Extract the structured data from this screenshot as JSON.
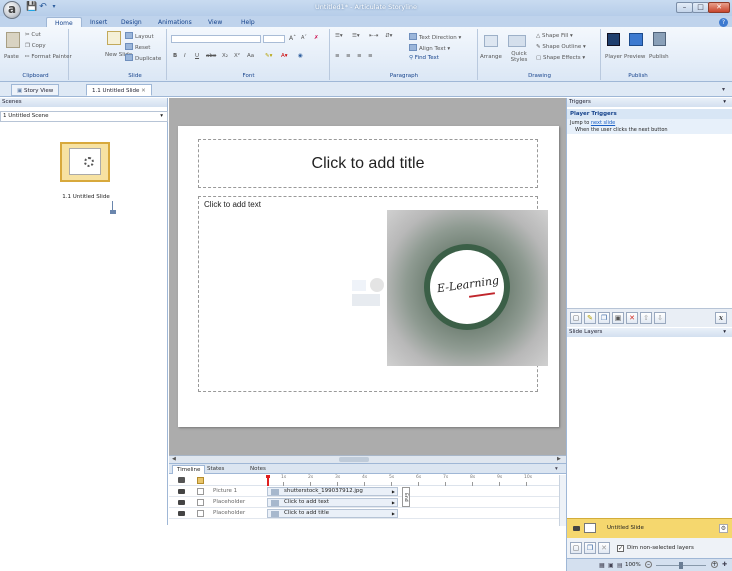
{
  "window": {
    "title": "Untitled1* - Articulate Storyline",
    "app_button": "a"
  },
  "qat": [
    "save-icon",
    "undo-icon",
    "dropdown-icon"
  ],
  "ribbon_tabs": [
    "Home",
    "Insert",
    "Design",
    "Animations",
    "View",
    "Help"
  ],
  "clipboard": {
    "paste": "Paste",
    "cut": "Cut",
    "copy": "Copy",
    "format_painter": "Format Painter",
    "label": "Clipboard"
  },
  "slide_group": {
    "new_slide": "New Slide",
    "layout": "Layout",
    "reset": "Reset",
    "duplicate": "Duplicate",
    "label": "Slide"
  },
  "font_group": {
    "label": "Font",
    "bold": "B",
    "italic": "I",
    "underline": "U",
    "strike": "abe",
    "sub": "X₂",
    "sup": "X²",
    "case": "Aa"
  },
  "paragraph_group": {
    "text_direction": "Text Direction",
    "align_text": "Align Text",
    "find_text": "Find Text",
    "label": "Paragraph"
  },
  "drawing_group": {
    "arrange": "Arrange",
    "quick_styles": "Quick Styles",
    "shape_fill": "Shape Fill",
    "shape_outline": "Shape Outline",
    "shape_effects": "Shape Effects",
    "label": "Drawing"
  },
  "publish_group": {
    "player": "Player",
    "preview": "Preview",
    "publish": "Publish",
    "label": "Publish"
  },
  "doc_tabs": [
    {
      "label": "Story View"
    },
    {
      "label": "1.1 Untitled Slide"
    }
  ],
  "scenes": {
    "header": "Scenes",
    "selected": "1 Untitled Scene",
    "thumb_label": "1.1 Untitled Slide"
  },
  "slide": {
    "title_placeholder": "Click to add title",
    "text_placeholder": "Click to add text",
    "image_text": "E-Learning"
  },
  "timeline": {
    "tabs": [
      "Timeline",
      "States",
      "Notes"
    ],
    "ticks": [
      "1s",
      "2s",
      "3s",
      "4s",
      "5s",
      "6s",
      "7s",
      "8s",
      "9s",
      "10s"
    ],
    "end_label": "End",
    "rows": [
      {
        "name": "Picture 1",
        "bar": "shutterstock_199037912.jpg"
      },
      {
        "name": "Placeholder",
        "bar": "Click to add text"
      },
      {
        "name": "Placeholder",
        "bar": "Click to add title"
      }
    ]
  },
  "triggers": {
    "header": "Triggers",
    "section": "Player Triggers",
    "trigger_prefix": "Jump to",
    "trigger_link": "next slide",
    "trigger_when": "When the user clicks the next button"
  },
  "layers": {
    "header": "Slide Layers",
    "base_layer": "Untitled Slide",
    "dim_label": "Dim non-selected layers",
    "zoom": "100%"
  }
}
